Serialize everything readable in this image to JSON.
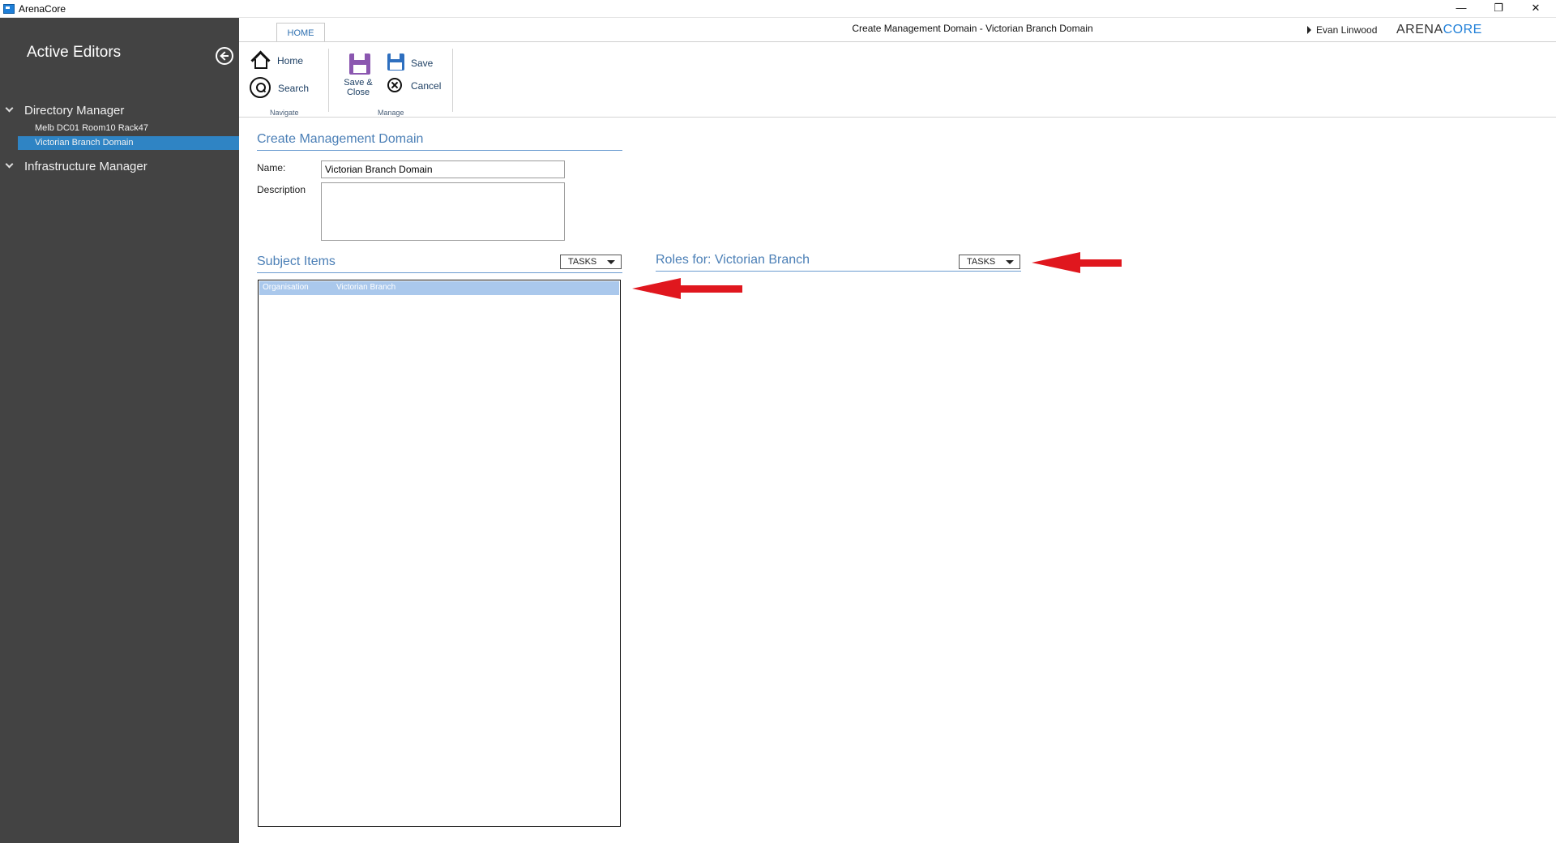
{
  "window": {
    "app_title": "ArenaCore",
    "minimize_glyph": "—",
    "maximize_glyph": "❐",
    "close_glyph": "✕"
  },
  "sidebar": {
    "title": "Active Editors",
    "groups": [
      {
        "label": "Directory Manager",
        "items": [
          "Melb DC01 Room10 Rack47",
          "Victorian Branch Domain"
        ]
      },
      {
        "label": "Infrastructure Manager",
        "items": []
      }
    ],
    "selected_item": "Victorian Branch Domain"
  },
  "header": {
    "tab_home": "HOME",
    "document_title": "Create Management Domain - Victorian Branch Domain",
    "user_name": "Evan Linwood",
    "brand_part1": "ARENA",
    "brand_part2": "CORE"
  },
  "ribbon": {
    "navigate": {
      "home_label": "Home",
      "search_label": "Search",
      "group_label": "Navigate"
    },
    "manage": {
      "save_close_label_line1": "Save &",
      "save_close_label_line2": "Close",
      "save_label": "Save",
      "cancel_label": "Cancel",
      "group_label": "Manage"
    }
  },
  "form": {
    "section_title": "Create Management Domain",
    "name_label": "Name:",
    "name_value": "Victorian Branch Domain",
    "description_label": "Description",
    "description_value": ""
  },
  "subject_items": {
    "title": "Subject Items",
    "tasks_label": "TASKS",
    "rows": [
      {
        "type": "Organisation",
        "name": "Victorian Branch"
      }
    ]
  },
  "roles": {
    "title": "Roles for: Victorian Branch",
    "tasks_label": "TASKS"
  },
  "colors": {
    "sidebar_bg": "#434343",
    "selection": "#2f84c4",
    "accent": "#4b7fb6",
    "annotation_arrow": "#e0171e",
    "disk_save_close": "#8b57b0",
    "disk_save": "#2e6fbf"
  }
}
